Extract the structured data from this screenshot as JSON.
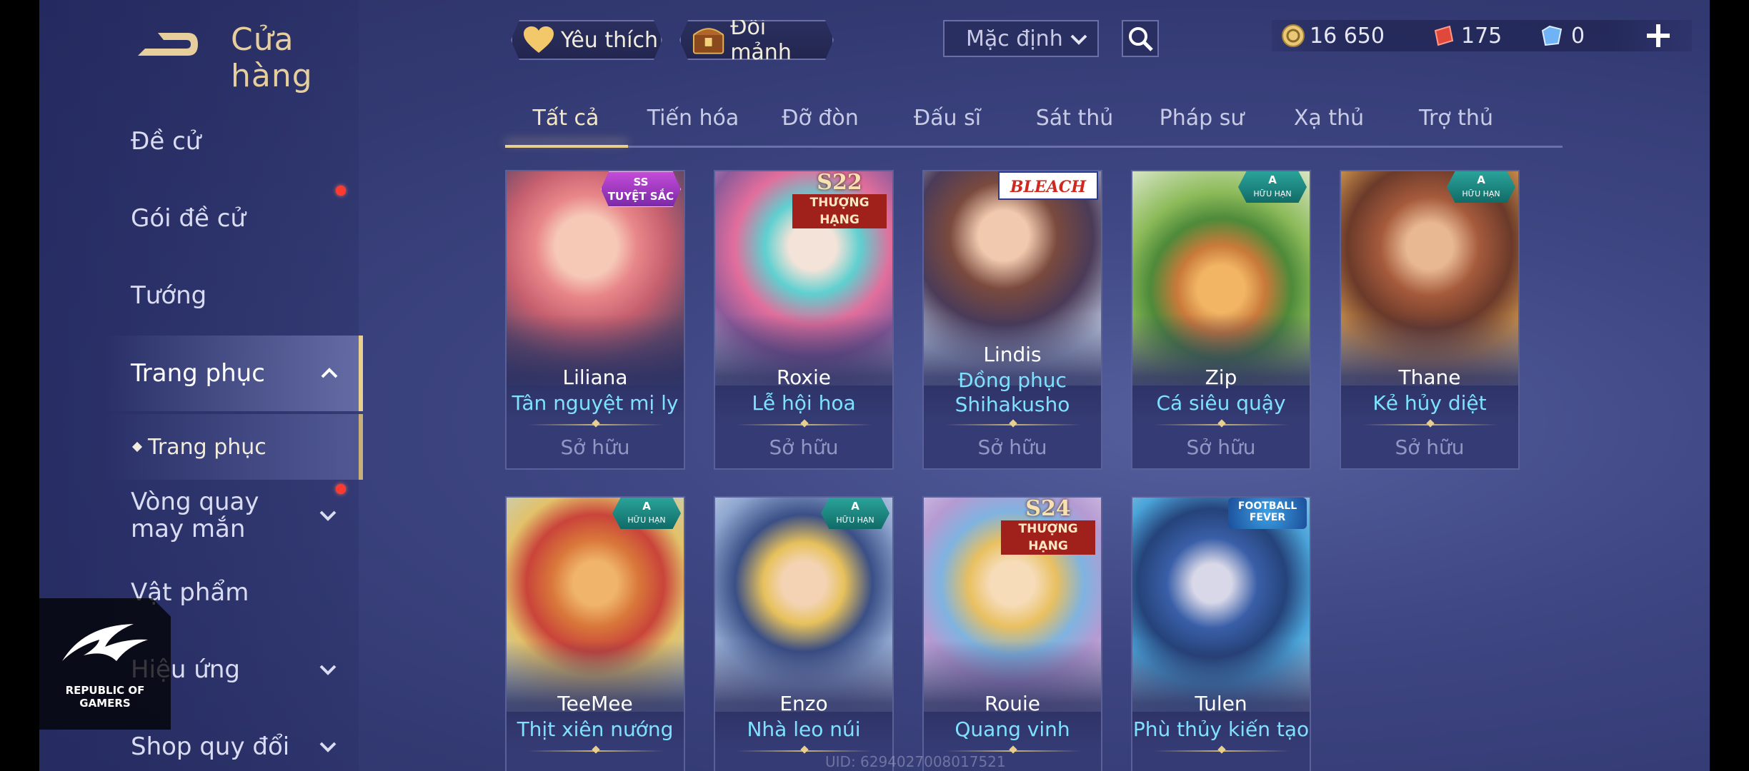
{
  "header": {
    "title": "Cửa hàng",
    "favorites_label": "Yêu thích",
    "exchange_label": "Đổi mảnh",
    "sort_value": "Mặc định"
  },
  "currency": {
    "gold": "16 650",
    "vouchers": "175",
    "gems": "0"
  },
  "sidebar": {
    "items": [
      {
        "label": "Đề cử"
      },
      {
        "label": "Gói đề cử"
      },
      {
        "label": "Tướng"
      },
      {
        "label": "Trang phục"
      },
      {
        "label": "Trang phục"
      },
      {
        "label": "Vòng quay may mắn"
      },
      {
        "label": "Vật phẩm"
      },
      {
        "label": "Hiệu ứng"
      },
      {
        "label": "Shop quy đổi"
      }
    ]
  },
  "watermark": {
    "rog_line1": "REPUBLIC OF",
    "rog_line2": "GAMERS"
  },
  "tabs": [
    {
      "label": "Tất cả"
    },
    {
      "label": "Tiến hóa"
    },
    {
      "label": "Đỡ đòn"
    },
    {
      "label": "Đấu sĩ"
    },
    {
      "label": "Sát thủ"
    },
    {
      "label": "Pháp sư"
    },
    {
      "label": "Xạ thủ"
    },
    {
      "label": "Trợ thủ"
    }
  ],
  "cards": [
    {
      "hero": "Liliana",
      "skin": "Tân nguyệt mị ly",
      "status": "Sở hữu",
      "badge_top": "SS",
      "badge_bottom": "TUYỆT SẮC"
    },
    {
      "hero": "Roxie",
      "skin": "Lễ hội hoa",
      "status": "Sở hữu",
      "badge_top": "S22",
      "badge_bottom": "THƯỢNG HẠNG"
    },
    {
      "hero": "Lindis",
      "skin_line1": "Đồng phục",
      "skin_line2": "Shihakusho",
      "status": "Sở hữu",
      "badge_top": "BLEACH"
    },
    {
      "hero": "Zip",
      "skin": "Cá siêu quậy",
      "status": "Sở hữu",
      "badge_top": "A",
      "badge_bottom": "HỮU HẠN"
    },
    {
      "hero": "Thane",
      "skin": "Kẻ hủy diệt",
      "status": "Sở hữu",
      "badge_top": "A",
      "badge_bottom": "HỮU HẠN"
    },
    {
      "hero": "TeeMee",
      "skin": "Thịt xiên nướng",
      "badge_top": "A",
      "badge_bottom": "HỮU HẠN"
    },
    {
      "hero": "Enzo",
      "skin": "Nhà leo núi",
      "badge_top": "A",
      "badge_bottom": "HỮU HẠN"
    },
    {
      "hero": "Rouie",
      "skin": "Quang vinh",
      "badge_top": "S24",
      "badge_bottom": "THƯỢNG HẠNG"
    },
    {
      "hero": "Tulen",
      "skin": "Phù thủy kiến tạo",
      "badge_top": "FOOTBALL FEVER"
    }
  ],
  "footer": {
    "uid": "UID: 6294027008017521"
  },
  "colors": {
    "accent_gold": "#e8cf8e",
    "skin_name": "#7fe1ff",
    "notification": "#ff3b30"
  }
}
